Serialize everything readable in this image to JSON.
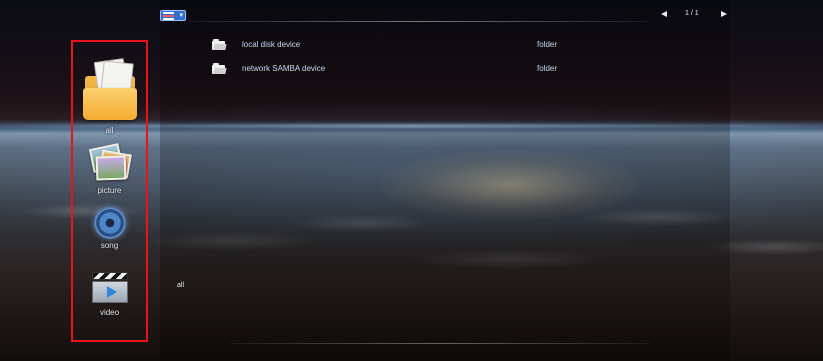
{
  "sidebar": {
    "items": [
      {
        "label": "all",
        "icon": "folder-icon"
      },
      {
        "label": "picture",
        "icon": "picture-icon"
      },
      {
        "label": "song",
        "icon": "music-disc-icon"
      },
      {
        "label": "video",
        "icon": "video-icon"
      }
    ],
    "highlight_color": "#e8141a"
  },
  "toolbar": {
    "view_toggle_icon": "list-view-icon",
    "pager_text": "1 / 1"
  },
  "files": [
    {
      "name": "local disk device",
      "type": "folder"
    },
    {
      "name": "network SAMBA device",
      "type": "folder"
    }
  ],
  "status": {
    "current_category": "all"
  }
}
